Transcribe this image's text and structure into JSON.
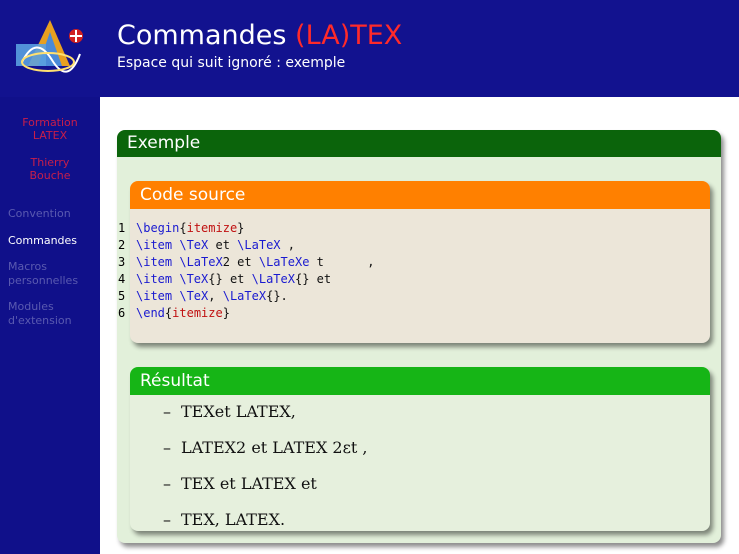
{
  "header": {
    "title_prefix": "Commandes ",
    "title_latex": "(LA)TEX",
    "subtitle": "Espace qui suit ignoré : exemple"
  },
  "sidebar": {
    "course": [
      "Formation",
      "LATEX"
    ],
    "author": [
      "Thierry",
      "Bouche"
    ],
    "items": [
      {
        "label": "Convention",
        "active": false
      },
      {
        "label": "Commandes",
        "active": true
      },
      {
        "label": "Macros personnelles",
        "active": false
      },
      {
        "label": "Modules d'extension",
        "active": false
      }
    ]
  },
  "example_block": {
    "title": "Exemple"
  },
  "code_block": {
    "title": "Code source",
    "lines": [
      {
        "n": "1",
        "text": "\\begin{itemize}"
      },
      {
        "n": "2",
        "text": "\\item \\TeX et \\LaTeX ,"
      },
      {
        "n": "3",
        "text": "\\item \\LaTeX2 et \\LaTeXe t      ,"
      },
      {
        "n": "4",
        "text": "\\item \\TeX{} et \\LaTeX{} et"
      },
      {
        "n": "5",
        "text": "\\item \\TeX, \\LaTeX{}."
      },
      {
        "n": "6",
        "text": "\\end{itemize}"
      }
    ]
  },
  "result_block": {
    "title": "Résultat",
    "items": [
      "TEXet LATEX,",
      "LATEX2 et LATEX 2εt ,",
      "TEX et LATEX et",
      "TEX, LATEX."
    ],
    "bullet": "–"
  },
  "colors": {
    "header_bg": "#12128f",
    "sidebar_bg": "#10108a",
    "example_head": "#0b640b",
    "code_head": "#ff8000",
    "result_head": "#16b516",
    "latex_red": "#ff2a2a"
  }
}
